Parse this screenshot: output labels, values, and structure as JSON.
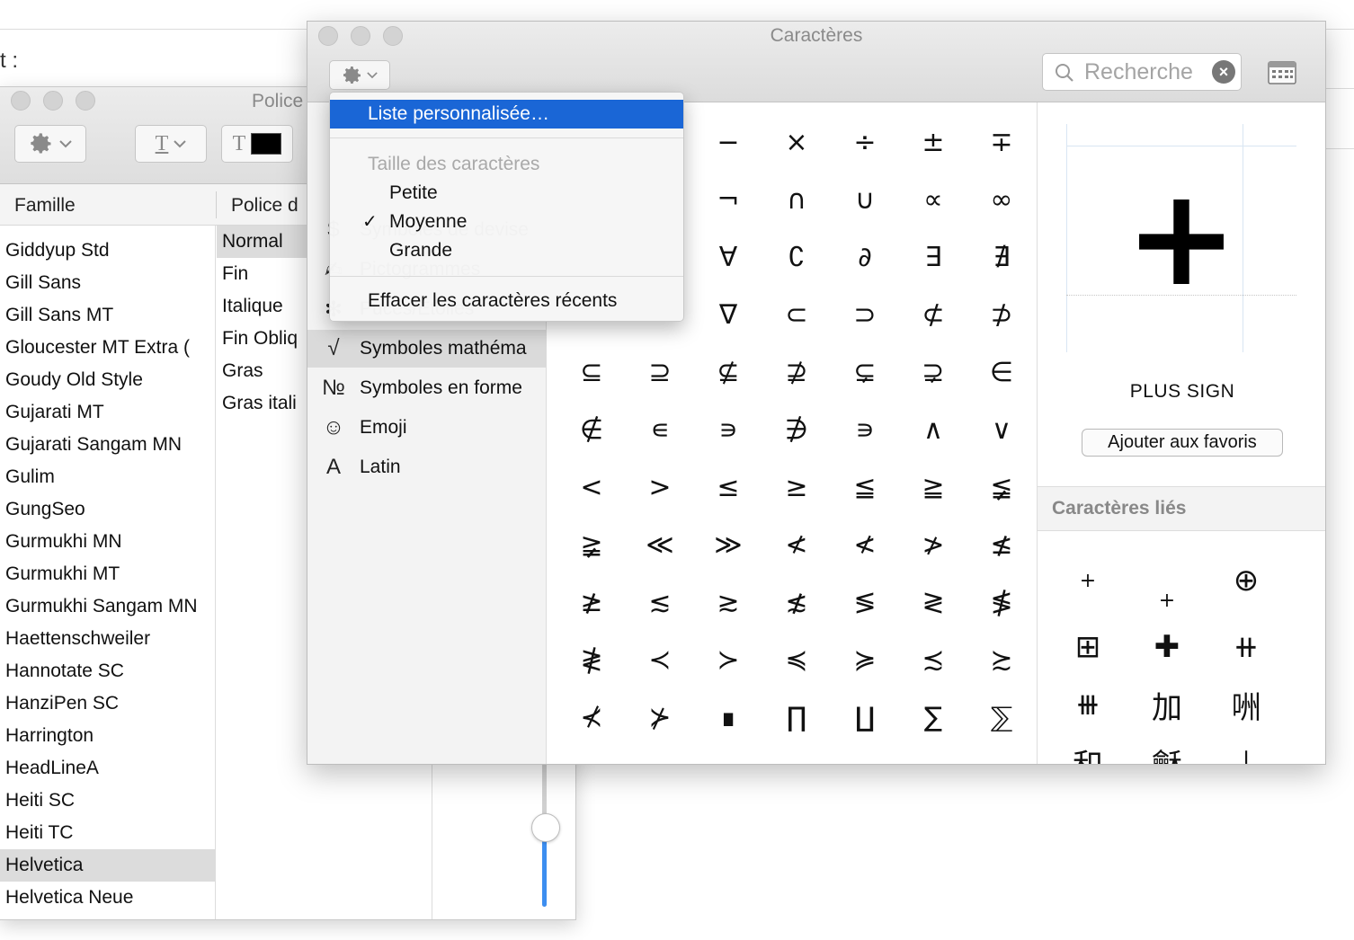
{
  "background_window": {
    "label": "t :"
  },
  "fonts_window": {
    "title": "Police",
    "columns": {
      "family": "Famille",
      "typeface": "Police d"
    },
    "families": [
      {
        "name": "Giddyup Std",
        "selected": false
      },
      {
        "name": "Gill Sans",
        "selected": false
      },
      {
        "name": "Gill Sans MT",
        "selected": false
      },
      {
        "name": "Gloucester MT Extra (",
        "selected": false
      },
      {
        "name": "Goudy Old Style",
        "selected": false
      },
      {
        "name": "Gujarati MT",
        "selected": false
      },
      {
        "name": "Gujarati Sangam MN",
        "selected": false
      },
      {
        "name": "Gulim",
        "selected": false
      },
      {
        "name": "GungSeo",
        "selected": false
      },
      {
        "name": "Gurmukhi MN",
        "selected": false
      },
      {
        "name": "Gurmukhi MT",
        "selected": false
      },
      {
        "name": "Gurmukhi Sangam MN",
        "selected": false
      },
      {
        "name": "Haettenschweiler",
        "selected": false
      },
      {
        "name": "Hannotate SC",
        "selected": false
      },
      {
        "name": "HanziPen SC",
        "selected": false
      },
      {
        "name": "Harrington",
        "selected": false
      },
      {
        "name": "HeadLineA",
        "selected": false
      },
      {
        "name": "Heiti SC",
        "selected": false
      },
      {
        "name": "Heiti TC",
        "selected": false
      },
      {
        "name": "Helvetica",
        "selected": true
      },
      {
        "name": "Helvetica Neue",
        "selected": false
      }
    ],
    "typefaces": [
      {
        "name": "Normal",
        "selected": true
      },
      {
        "name": "Fin",
        "selected": false
      },
      {
        "name": "Italique",
        "selected": false
      },
      {
        "name": "Fin Obliq",
        "selected": false
      },
      {
        "name": "Gras",
        "selected": false
      },
      {
        "name": "Gras itali",
        "selected": false
      }
    ],
    "toolbar": {
      "text_style_glyph": "T",
      "text_color_glyph": "T",
      "text_color": "#000000"
    },
    "size_slider_value": 0.6
  },
  "characters_window": {
    "title": "Caractères",
    "search": {
      "placeholder": "Recherche"
    },
    "categories": [
      {
        "icon": "$",
        "icon_name": "currency-icon",
        "label": "Symboles de devise",
        "selected": false
      },
      {
        "icon": "✍",
        "icon_name": "pictograph-icon",
        "label": "Pictogrammes",
        "selected": false
      },
      {
        "icon": "✻",
        "icon_name": "star-icon",
        "label": "Puces/Étoiles",
        "selected": false
      },
      {
        "icon": "√",
        "icon_name": "sqrt-icon",
        "label": "Symboles mathéma",
        "selected": true
      },
      {
        "icon": "№",
        "icon_name": "numero-icon",
        "label": "Symboles en forme",
        "selected": false
      },
      {
        "icon": "☺",
        "icon_name": "smiley-icon",
        "label": "Emoji",
        "selected": false
      },
      {
        "icon": "A",
        "icon_name": "latin-a-icon",
        "label": "Latin",
        "selected": false
      }
    ],
    "character_grid": [
      [
        "",
        "",
        "−",
        "×",
        "÷",
        "±",
        "∓"
      ],
      [
        "",
        "",
        "¬",
        "∩",
        "∪",
        "∝",
        "∞"
      ],
      [
        "",
        "",
        "∀",
        "∁",
        "∂",
        "∃",
        "∄"
      ],
      [
        "",
        "",
        "∇",
        "⊂",
        "⊃",
        "⊄",
        "⊅"
      ],
      [
        "⊆",
        "⊇",
        "⊈",
        "⊉",
        "⊊",
        "⊋",
        "∈"
      ],
      [
        "∉",
        "∊",
        "∍",
        "∌",
        "∍",
        "∧",
        "∨"
      ],
      [
        "<",
        ">",
        "≤",
        "≥",
        "≦",
        "≧",
        "≨"
      ],
      [
        "≩",
        "≪",
        "≫",
        "≮",
        "≮",
        "≯",
        "≰"
      ],
      [
        "≱",
        "≲",
        "≳",
        "≴",
        "≶",
        "≷",
        "≸"
      ],
      [
        "≹",
        "≺",
        "≻",
        "≼",
        "≽",
        "≾",
        "≿"
      ],
      [
        "⊀",
        "⊁",
        "∎",
        "∏",
        "∐",
        "∑",
        "⅀"
      ]
    ],
    "selected_character": {
      "glyph": "+",
      "name": "PLUS SIGN"
    },
    "favorites_button": "Ajouter aux favoris",
    "related_title": "Caractères liés",
    "related": [
      "+",
      "+",
      "⊕",
      "⊞",
      "✚",
      "⧺",
      "⧻",
      "加",
      "㖄",
      "和",
      "龢",
      "⊥"
    ]
  },
  "gear_menu": {
    "custom_list": "Liste personnalisée…",
    "size_header": "Taille des caractères",
    "sizes": [
      {
        "label": "Petite",
        "checked": false
      },
      {
        "label": "Moyenne",
        "checked": true
      },
      {
        "label": "Grande",
        "checked": false
      }
    ],
    "check_glyph": "✓",
    "clear_recent": "Effacer les caractères récents"
  }
}
